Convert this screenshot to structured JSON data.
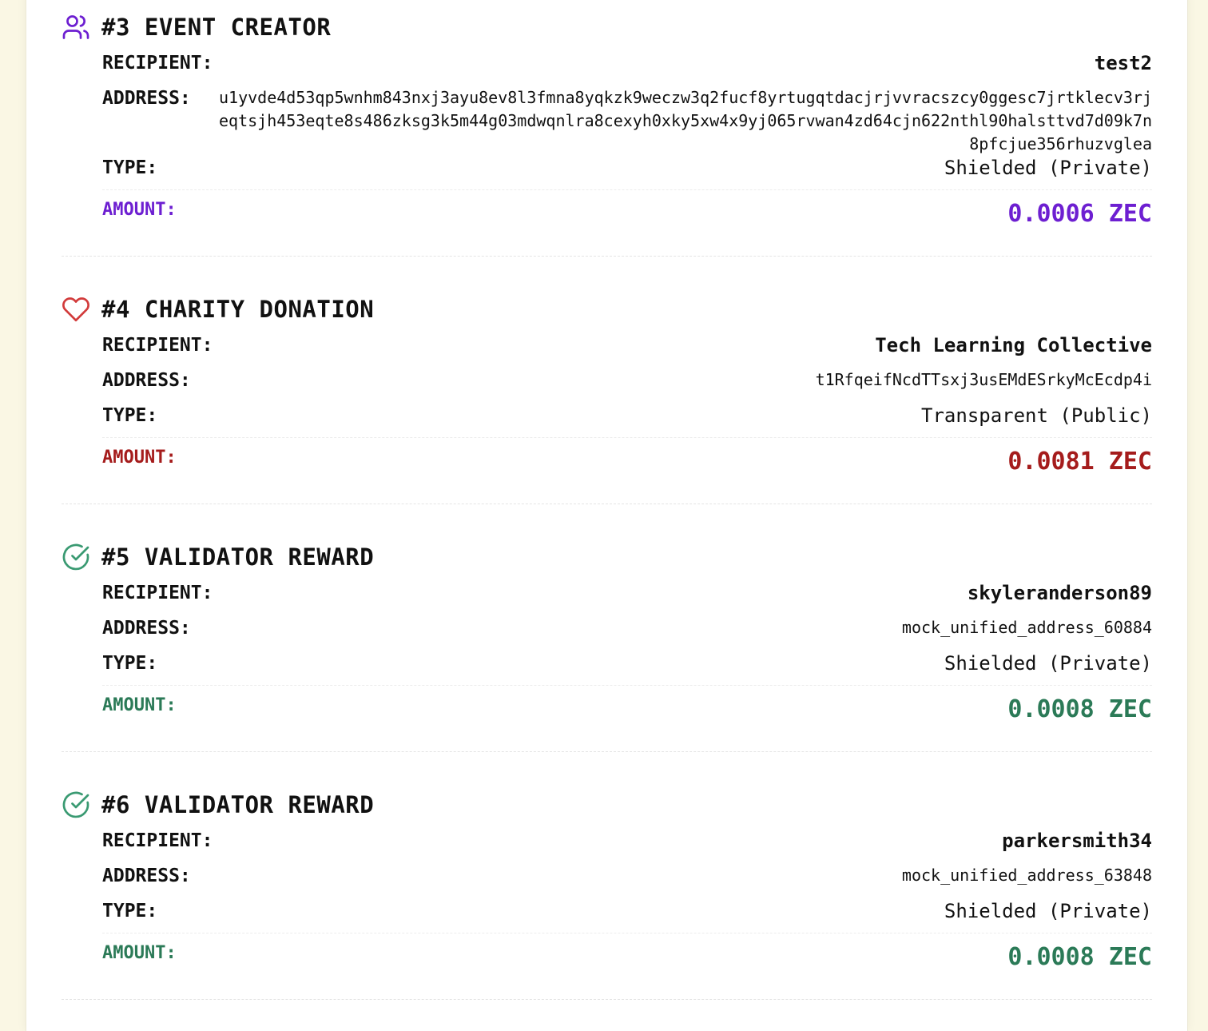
{
  "labels": {
    "recipient": "RECIPIENT:",
    "address": "ADDRESS:",
    "type": "TYPE:",
    "amount": "AMOUNT:"
  },
  "entries": [
    {
      "title": "#3 EVENT CREATOR",
      "icon": "users-icon",
      "color": "#6d1fd1",
      "recipient": "test2",
      "address": "u1yvde4d53qp5wnhm843nxj3ayu8ev8l3fmna8yqkzk9weczw3q2fucf8yrtugqtdacjrjvvracszcy0ggesc7jrtklecv3rjeqtsjh453eqte8s486zksg3k5m44g03mdwqnlra8cexyh0xky5xw4x9yj065rvwan4zd64cjn622nthl90halsttvd7d09k7n8pfcjue356rhuzvglea",
      "type": "Shielded (Private)",
      "amount": "0.0006 ZEC"
    },
    {
      "title": "#4 CHARITY DONATION",
      "icon": "heart-icon",
      "color": "#a51c1c",
      "recipient": "Tech Learning Collective",
      "address": "t1RfqeifNcdTTsxj3usEMdESrkyMcEcdp4i",
      "type": "Transparent (Public)",
      "amount": "0.0081 ZEC"
    },
    {
      "title": "#5 VALIDATOR REWARD",
      "icon": "check-circle-icon",
      "color": "#2b7a57",
      "recipient": "skyleranderson89",
      "address": "mock_unified_address_60884",
      "type": "Shielded (Private)",
      "amount": "0.0008 ZEC"
    },
    {
      "title": "#6 VALIDATOR REWARD",
      "icon": "check-circle-icon",
      "color": "#2b7a57",
      "recipient": "parkersmith34",
      "address": "mock_unified_address_63848",
      "type": "Shielded (Private)",
      "amount": "0.0008 ZEC"
    }
  ]
}
